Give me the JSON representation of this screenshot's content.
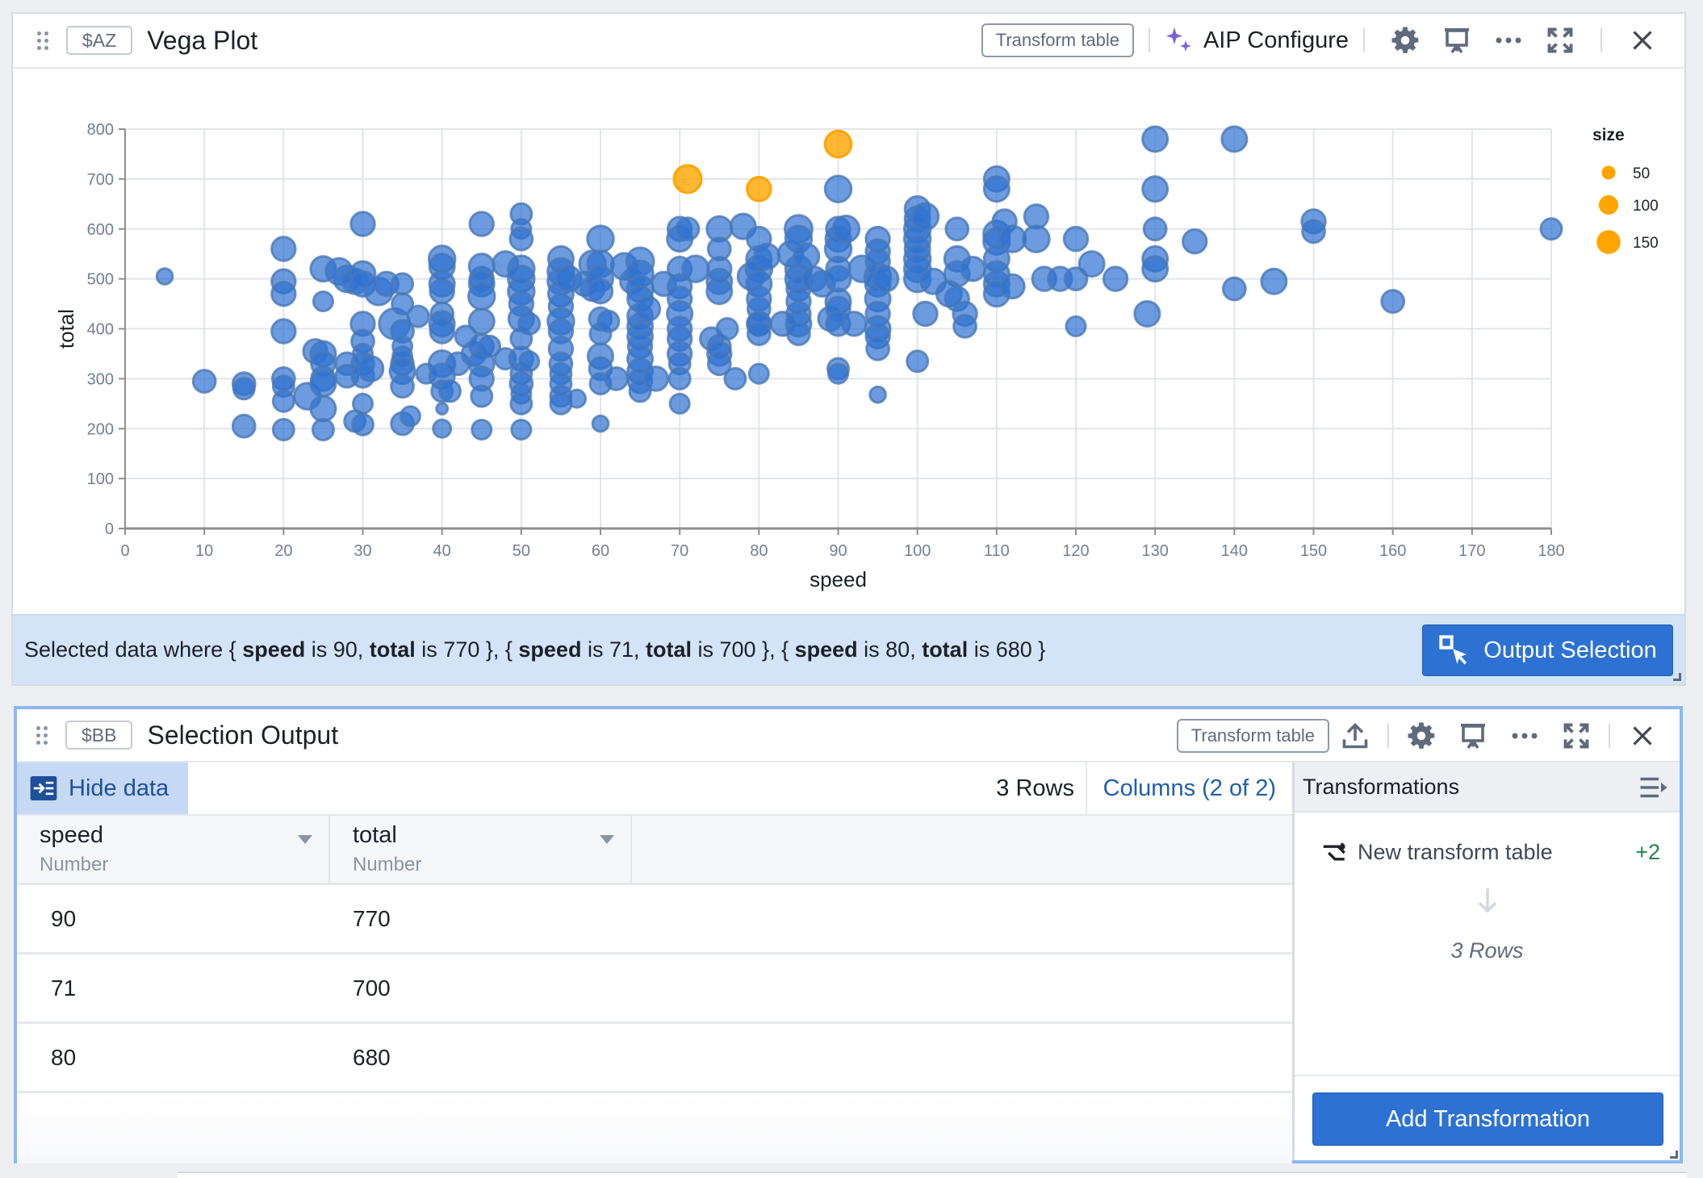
{
  "top_panel": {
    "variable_tag": "$AZ",
    "title": "Vega Plot",
    "transform_button": "Transform table",
    "aip_label": "AIP Configure",
    "icons": [
      "drag-handle-icon",
      "sparkle-icon",
      "gear-icon",
      "presentation-icon",
      "more-icon",
      "maximize-icon",
      "close-icon"
    ]
  },
  "selection_bar": {
    "prefix": "Selected data where",
    "items": [
      {
        "speed": "90",
        "total": "770"
      },
      {
        "speed": "71",
        "total": "700"
      },
      {
        "speed": "80",
        "total": "680"
      }
    ],
    "field_speed": "speed",
    "field_total": "total",
    "connector": "is",
    "button_label": "Output Selection"
  },
  "bottom_panel": {
    "variable_tag": "$BB",
    "title": "Selection Output",
    "transform_button": "Transform table",
    "hide_data_label": "Hide data",
    "rows_count": "3 Rows",
    "columns_link": "Columns (2 of 2)",
    "columns": [
      {
        "name": "speed",
        "type": "Number"
      },
      {
        "name": "total",
        "type": "Number"
      }
    ],
    "rows": [
      [
        "90",
        "770"
      ],
      [
        "71",
        "700"
      ],
      [
        "80",
        "680"
      ]
    ],
    "transformations": {
      "title": "Transformations",
      "item_label": "New transform table",
      "item_count": "+2",
      "result_label": "3 Rows",
      "add_button": "Add Transformation"
    }
  },
  "colors": {
    "point": "#2d72d2",
    "selected": "#ffa500",
    "primary_button": "#2d72d2",
    "selection_bar_bg": "#d3e4f9",
    "aip_sparkle": "#7961db",
    "added_count": "#238551"
  },
  "chart_data": {
    "type": "scatter",
    "title": "",
    "xlabel": "speed",
    "ylabel": "total",
    "xlim": [
      0,
      180
    ],
    "ylim": [
      0,
      800
    ],
    "x_ticks": [
      0,
      10,
      20,
      30,
      40,
      50,
      60,
      70,
      80,
      90,
      100,
      110,
      120,
      130,
      140,
      150,
      160,
      170,
      180
    ],
    "y_ticks": [
      0,
      100,
      200,
      300,
      400,
      500,
      600,
      700,
      800
    ],
    "grid": true,
    "legend": {
      "title": "size",
      "position": "right",
      "entries": [
        50,
        100,
        150
      ]
    },
    "selected": [
      {
        "speed": 90,
        "total": 770,
        "size": 110
      },
      {
        "speed": 71,
        "total": 700,
        "size": 120
      },
      {
        "speed": 80,
        "total": 680,
        "size": 90
      }
    ],
    "points": [
      [
        5,
        505,
        40
      ],
      [
        10,
        295,
        80
      ],
      [
        15,
        290,
        80
      ],
      [
        15,
        280,
        70
      ],
      [
        15,
        205,
        80
      ],
      [
        20,
        560,
        90
      ],
      [
        20,
        495,
        90
      ],
      [
        20,
        470,
        90
      ],
      [
        20,
        395,
        90
      ],
      [
        20,
        300,
        80
      ],
      [
        20,
        285,
        70
      ],
      [
        20,
        255,
        70
      ],
      [
        20,
        198,
        70
      ],
      [
        23,
        265,
        110
      ],
      [
        24,
        355,
        90
      ],
      [
        25,
        520,
        100
      ],
      [
        25,
        455,
        60
      ],
      [
        25,
        350,
        100
      ],
      [
        25,
        330,
        90
      ],
      [
        25,
        300,
        90
      ],
      [
        25,
        290,
        100
      ],
      [
        25,
        240,
        100
      ],
      [
        25,
        198,
        70
      ],
      [
        27,
        515,
        110
      ],
      [
        28,
        500,
        110
      ],
      [
        28,
        330,
        80
      ],
      [
        28,
        305,
        80
      ],
      [
        29,
        495,
        100
      ],
      [
        29,
        215,
        70
      ],
      [
        30,
        610,
        90
      ],
      [
        30,
        510,
        100
      ],
      [
        30,
        490,
        100
      ],
      [
        30,
        410,
        90
      ],
      [
        30,
        375,
        80
      ],
      [
        30,
        350,
        60
      ],
      [
        30,
        330,
        80
      ],
      [
        30,
        305,
        80
      ],
      [
        30,
        250,
        60
      ],
      [
        30,
        208,
        70
      ],
      [
        31,
        320,
        100
      ],
      [
        32,
        475,
        120
      ],
      [
        33,
        490,
        90
      ],
      [
        34,
        410,
        150
      ],
      [
        35,
        330,
        80
      ],
      [
        35,
        490,
        70
      ],
      [
        35,
        450,
        70
      ],
      [
        35,
        395,
        80
      ],
      [
        35,
        365,
        60
      ],
      [
        35,
        345,
        60
      ],
      [
        35,
        315,
        100
      ],
      [
        35,
        285,
        80
      ],
      [
        35,
        210,
        80
      ],
      [
        36,
        225,
        60
      ],
      [
        37,
        425,
        70
      ],
      [
        38,
        310,
        60
      ],
      [
        40,
        540,
        110
      ],
      [
        40,
        525,
        100
      ],
      [
        40,
        490,
        100
      ],
      [
        40,
        475,
        90
      ],
      [
        40,
        430,
        80
      ],
      [
        40,
        410,
        100
      ],
      [
        40,
        395,
        90
      ],
      [
        40,
        330,
        110
      ],
      [
        40,
        305,
        100
      ],
      [
        40,
        275,
        70
      ],
      [
        40,
        200,
        50
      ],
      [
        40,
        240,
        20
      ],
      [
        41,
        275,
        70
      ],
      [
        42,
        330,
        80
      ],
      [
        43,
        385,
        70
      ],
      [
        44,
        350,
        90
      ],
      [
        45,
        500,
        90
      ],
      [
        45,
        610,
        90
      ],
      [
        45,
        525,
        100
      ],
      [
        45,
        490,
        100
      ],
      [
        45,
        465,
        110
      ],
      [
        45,
        415,
        100
      ],
      [
        45,
        365,
        90
      ],
      [
        45,
        330,
        100
      ],
      [
        45,
        300,
        90
      ],
      [
        45,
        265,
        70
      ],
      [
        45,
        198,
        60
      ],
      [
        46,
        365,
        70
      ],
      [
        48,
        530,
        100
      ],
      [
        48,
        340,
        70
      ],
      [
        50,
        630,
        70
      ],
      [
        50,
        600,
        60
      ],
      [
        50,
        580,
        80
      ],
      [
        50,
        520,
        110
      ],
      [
        50,
        500,
        110
      ],
      [
        50,
        475,
        110
      ],
      [
        50,
        450,
        90
      ],
      [
        50,
        420,
        100
      ],
      [
        50,
        380,
        70
      ],
      [
        50,
        340,
        90
      ],
      [
        50,
        310,
        70
      ],
      [
        50,
        290,
        80
      ],
      [
        50,
        270,
        60
      ],
      [
        50,
        250,
        70
      ],
      [
        50,
        198,
        60
      ],
      [
        51,
        410,
        70
      ],
      [
        51,
        335,
        60
      ],
      [
        55,
        540,
        100
      ],
      [
        55,
        515,
        110
      ],
      [
        55,
        495,
        110
      ],
      [
        55,
        470,
        100
      ],
      [
        55,
        445,
        90
      ],
      [
        55,
        415,
        110
      ],
      [
        55,
        395,
        90
      ],
      [
        55,
        360,
        90
      ],
      [
        55,
        330,
        80
      ],
      [
        55,
        310,
        70
      ],
      [
        55,
        290,
        70
      ],
      [
        55,
        265,
        70
      ],
      [
        55,
        250,
        70
      ],
      [
        56,
        500,
        100
      ],
      [
        57,
        260,
        50
      ],
      [
        58,
        490,
        90
      ],
      [
        59,
        530,
        110
      ],
      [
        59,
        480,
        90
      ],
      [
        60,
        580,
        110
      ],
      [
        60,
        530,
        110
      ],
      [
        60,
        500,
        100
      ],
      [
        60,
        475,
        90
      ],
      [
        60,
        420,
        80
      ],
      [
        60,
        390,
        70
      ],
      [
        60,
        345,
        100
      ],
      [
        60,
        320,
        80
      ],
      [
        60,
        290,
        70
      ],
      [
        60,
        210,
        40
      ],
      [
        61,
        415,
        70
      ],
      [
        62,
        300,
        80
      ],
      [
        63,
        525,
        110
      ],
      [
        64,
        495,
        90
      ],
      [
        65,
        535,
        120
      ],
      [
        65,
        510,
        110
      ],
      [
        65,
        480,
        110
      ],
      [
        65,
        460,
        100
      ],
      [
        65,
        425,
        100
      ],
      [
        65,
        405,
        100
      ],
      [
        65,
        385,
        100
      ],
      [
        65,
        365,
        90
      ],
      [
        65,
        340,
        100
      ],
      [
        65,
        315,
        100
      ],
      [
        65,
        295,
        90
      ],
      [
        65,
        275,
        70
      ],
      [
        66,
        440,
        90
      ],
      [
        67,
        300,
        90
      ],
      [
        68,
        490,
        90
      ],
      [
        70,
        600,
        90
      ],
      [
        70,
        580,
        100
      ],
      [
        70,
        520,
        90
      ],
      [
        70,
        485,
        90
      ],
      [
        70,
        460,
        90
      ],
      [
        70,
        430,
        100
      ],
      [
        70,
        400,
        90
      ],
      [
        70,
        380,
        90
      ],
      [
        70,
        350,
        90
      ],
      [
        70,
        330,
        70
      ],
      [
        70,
        300,
        70
      ],
      [
        70,
        250,
        60
      ],
      [
        71,
        600,
        80
      ],
      [
        72,
        520,
        110
      ],
      [
        74,
        380,
        80
      ],
      [
        75,
        365,
        80
      ],
      [
        75,
        600,
        100
      ],
      [
        75,
        560,
        80
      ],
      [
        75,
        520,
        90
      ],
      [
        75,
        495,
        100
      ],
      [
        75,
        475,
        100
      ],
      [
        75,
        350,
        90
      ],
      [
        75,
        330,
        80
      ],
      [
        76,
        400,
        70
      ],
      [
        77,
        300,
        70
      ],
      [
        78,
        605,
        100
      ],
      [
        79,
        505,
        110
      ],
      [
        80,
        580,
        90
      ],
      [
        80,
        540,
        100
      ],
      [
        80,
        520,
        110
      ],
      [
        80,
        490,
        100
      ],
      [
        80,
        460,
        90
      ],
      [
        80,
        440,
        80
      ],
      [
        80,
        410,
        90
      ],
      [
        80,
        410,
        80
      ],
      [
        80,
        390,
        80
      ],
      [
        80,
        310,
        60
      ],
      [
        81,
        545,
        100
      ],
      [
        83,
        410,
        90
      ],
      [
        84,
        550,
        100
      ],
      [
        85,
        600,
        120
      ],
      [
        85,
        580,
        110
      ],
      [
        85,
        520,
        110
      ],
      [
        85,
        500,
        110
      ],
      [
        85,
        480,
        90
      ],
      [
        85,
        455,
        90
      ],
      [
        85,
        430,
        90
      ],
      [
        85,
        410,
        100
      ],
      [
        85,
        390,
        80
      ],
      [
        86,
        545,
        100
      ],
      [
        87,
        500,
        90
      ],
      [
        88,
        490,
        100
      ],
      [
        89,
        420,
        90
      ],
      [
        90,
        680,
        110
      ],
      [
        90,
        600,
        90
      ],
      [
        90,
        580,
        100
      ],
      [
        90,
        560,
        110
      ],
      [
        90,
        520,
        90
      ],
      [
        90,
        500,
        100
      ],
      [
        90,
        455,
        100
      ],
      [
        90,
        440,
        90
      ],
      [
        90,
        410,
        90
      ],
      [
        90,
        320,
        70
      ],
      [
        90,
        310,
        60
      ],
      [
        91,
        600,
        110
      ],
      [
        92,
        410,
        90
      ],
      [
        93,
        520,
        110
      ],
      [
        95,
        580,
        90
      ],
      [
        95,
        555,
        90
      ],
      [
        95,
        535,
        90
      ],
      [
        95,
        505,
        110
      ],
      [
        95,
        490,
        100
      ],
      [
        95,
        460,
        100
      ],
      [
        95,
        430,
        90
      ],
      [
        95,
        400,
        100
      ],
      [
        95,
        385,
        90
      ],
      [
        95,
        360,
        80
      ],
      [
        95,
        268,
        40
      ],
      [
        96,
        500,
        100
      ],
      [
        100,
        640,
        100
      ],
      [
        100,
        620,
        100
      ],
      [
        100,
        600,
        110
      ],
      [
        100,
        580,
        110
      ],
      [
        100,
        560,
        100
      ],
      [
        100,
        540,
        110
      ],
      [
        100,
        520,
        110
      ],
      [
        100,
        500,
        110
      ],
      [
        100,
        335,
        70
      ],
      [
        101,
        625,
        110
      ],
      [
        101,
        430,
        90
      ],
      [
        102,
        495,
        100
      ],
      [
        105,
        600,
        80
      ],
      [
        105,
        540,
        100
      ],
      [
        105,
        510,
        100
      ],
      [
        104,
        470,
        100
      ],
      [
        105,
        460,
        90
      ],
      [
        106,
        430,
        90
      ],
      [
        106,
        405,
        80
      ],
      [
        107,
        520,
        90
      ],
      [
        110,
        700,
        100
      ],
      [
        110,
        680,
        100
      ],
      [
        110,
        590,
        110
      ],
      [
        110,
        575,
        110
      ],
      [
        110,
        540,
        100
      ],
      [
        110,
        510,
        100
      ],
      [
        110,
        490,
        100
      ],
      [
        110,
        470,
        100
      ],
      [
        111,
        615,
        90
      ],
      [
        112,
        580,
        110
      ],
      [
        112,
        485,
        90
      ],
      [
        115,
        625,
        90
      ],
      [
        115,
        580,
        110
      ],
      [
        116,
        500,
        90
      ],
      [
        118,
        500,
        90
      ],
      [
        120,
        580,
        90
      ],
      [
        120,
        500,
        80
      ],
      [
        120,
        405,
        60
      ],
      [
        122,
        530,
        100
      ],
      [
        125,
        500,
        90
      ],
      [
        129,
        430,
        100
      ],
      [
        130,
        780,
        100
      ],
      [
        130,
        680,
        100
      ],
      [
        130,
        600,
        80
      ],
      [
        130,
        540,
        100
      ],
      [
        130,
        520,
        100
      ],
      [
        135,
        575,
        90
      ],
      [
        140,
        780,
        100
      ],
      [
        140,
        480,
        80
      ],
      [
        145,
        495,
        100
      ],
      [
        150,
        615,
        90
      ],
      [
        150,
        595,
        80
      ],
      [
        160,
        455,
        80
      ],
      [
        180,
        600,
        70
      ]
    ]
  }
}
